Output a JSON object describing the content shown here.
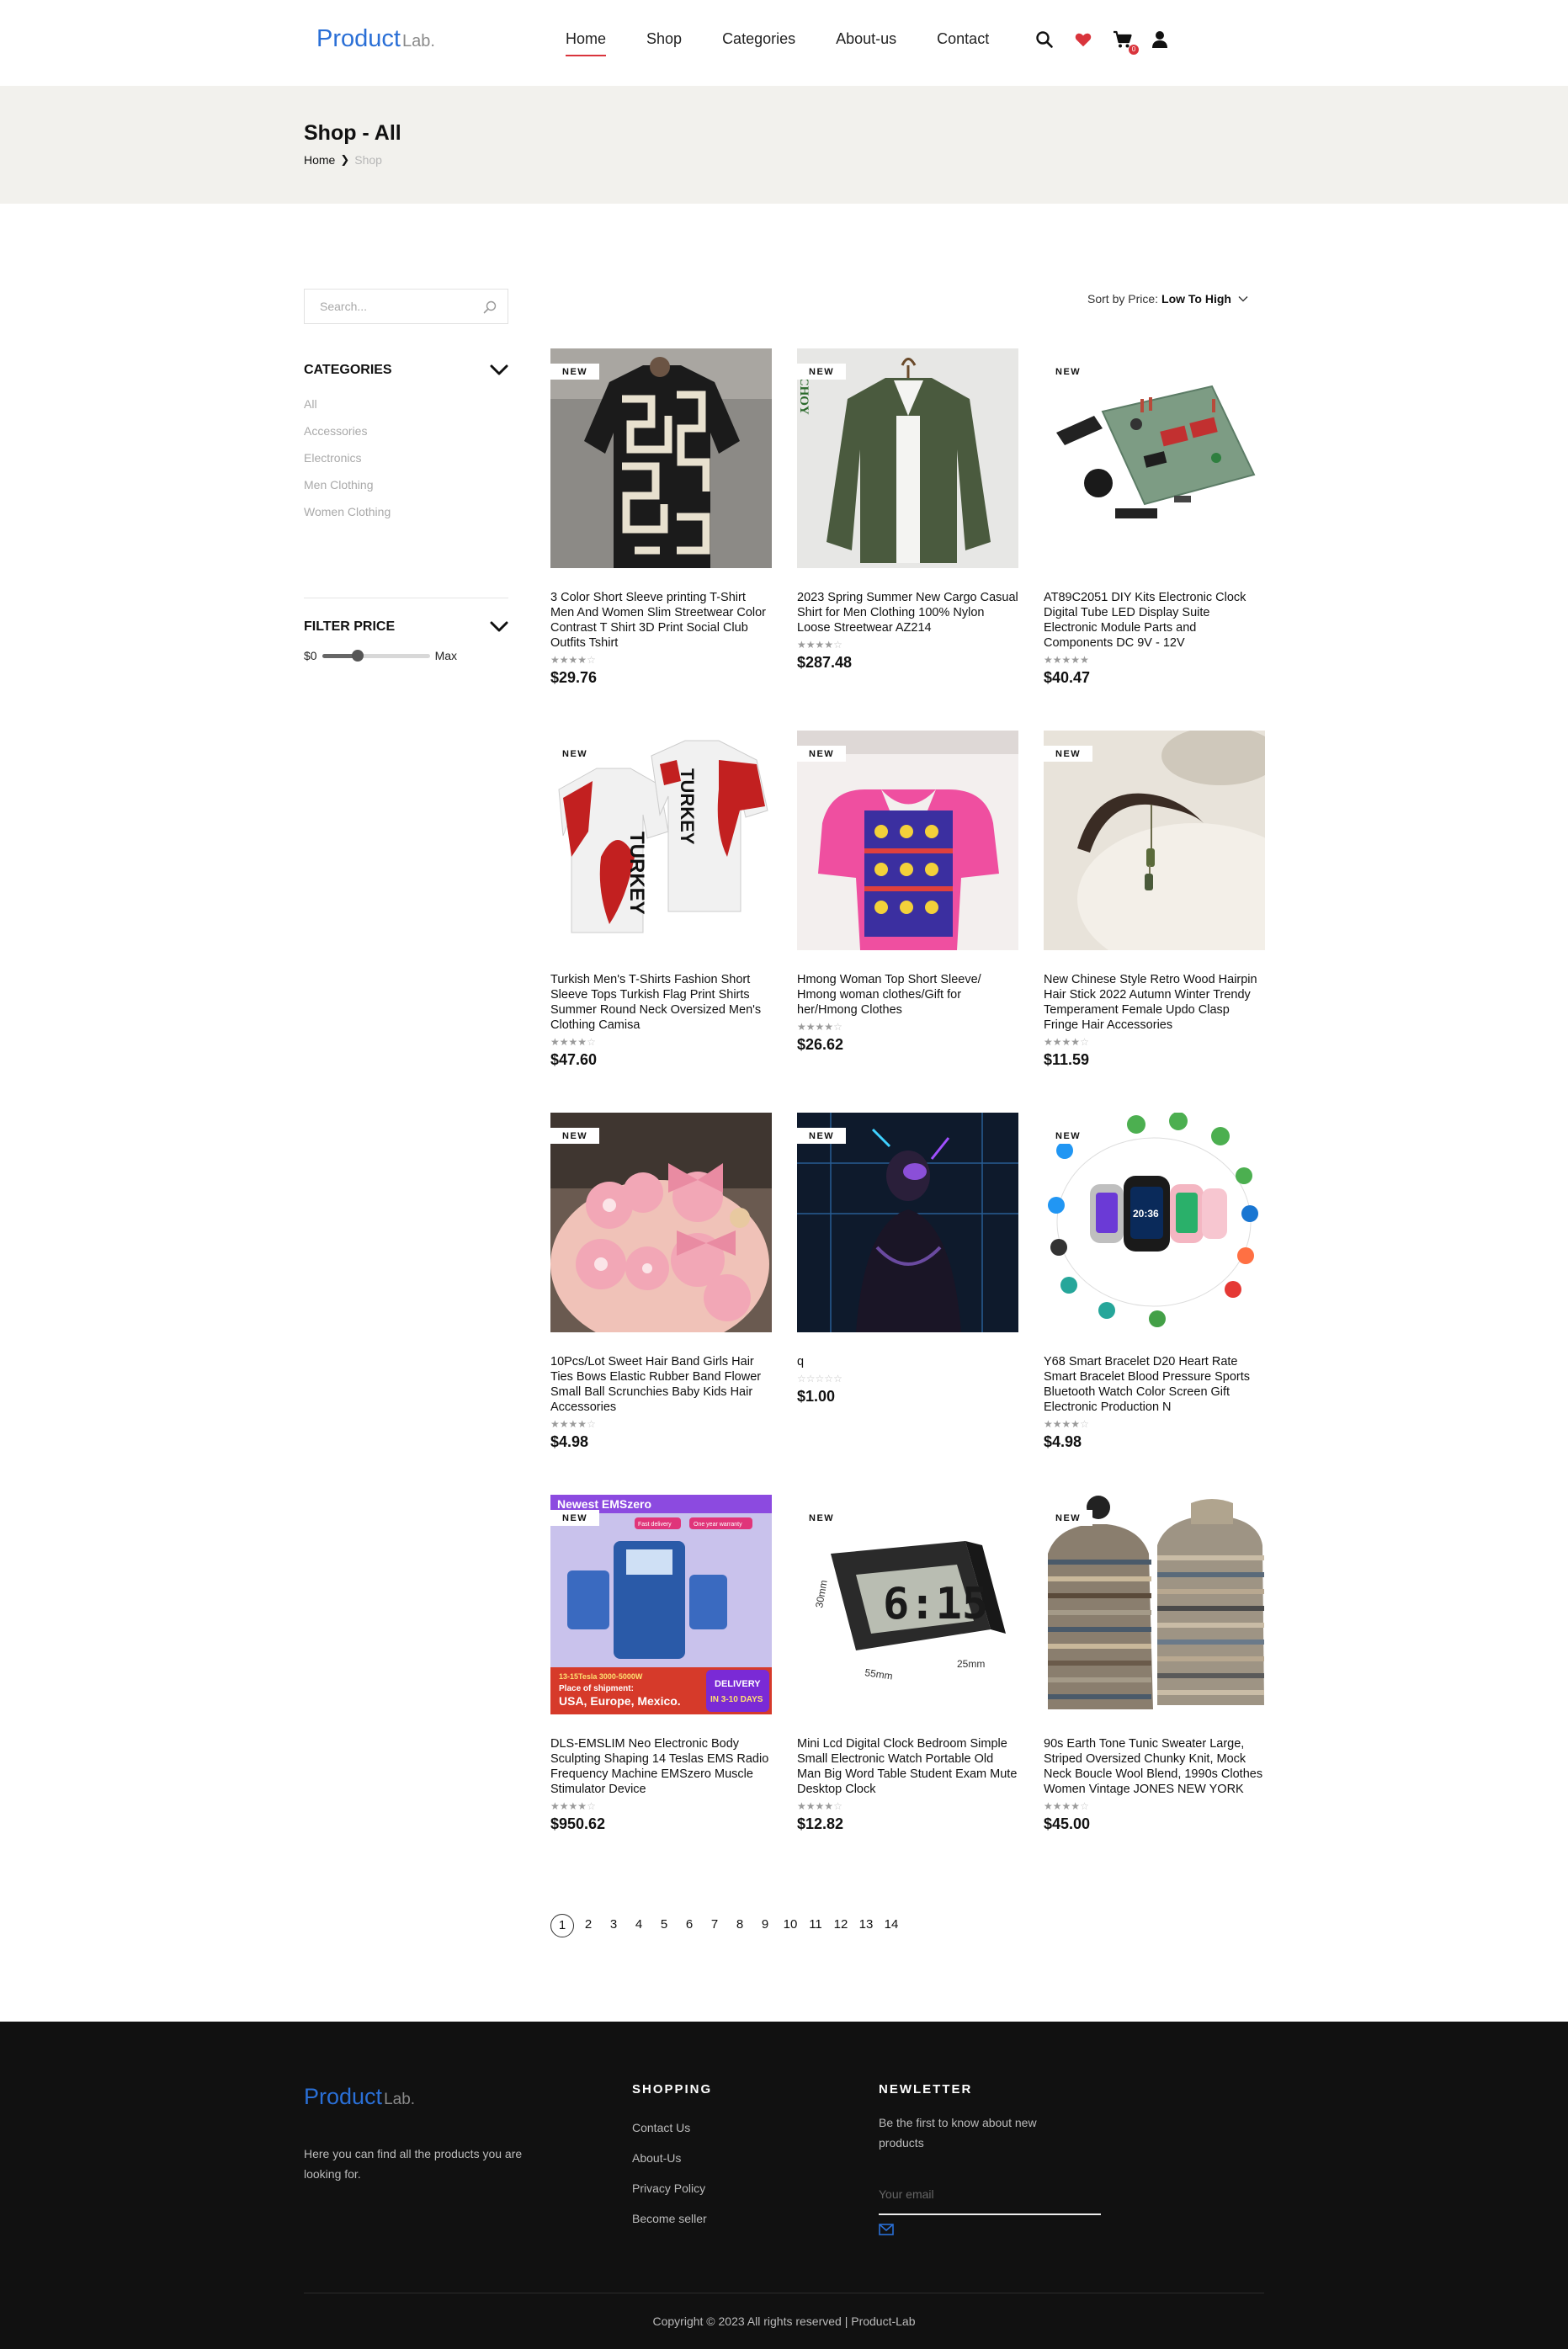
{
  "header": {
    "logo_main": "Product",
    "logo_sub": "Lab.",
    "nav": [
      "Home",
      "Shop",
      "Categories",
      "About-us",
      "Contact"
    ],
    "active_nav": "Home",
    "cart_count": "0",
    "icons": [
      "search-icon",
      "heart-icon",
      "cart-icon",
      "user-icon"
    ],
    "accent_color": "#d9343c",
    "brand_color": "#2a6fd6"
  },
  "banner": {
    "title": "Shop - All",
    "breadcrumb_home": "Home",
    "breadcrumb_current": "Shop"
  },
  "sidebar": {
    "search_placeholder": "Search...",
    "categories_title": "CATEGORIES",
    "categories": [
      "All",
      "Accessories",
      "Electronics",
      "Men Clothing",
      "Women Clothing"
    ],
    "filter_title": "FILTER PRICE",
    "price_min_label": "$0",
    "price_max_label": "Max",
    "slider_fraction": 0.33
  },
  "sort": {
    "label": "Sort by Price:",
    "value": "Low To High"
  },
  "products": [
    {
      "name": "3 Color Short Sleeve printing T-Shirt Men And Women Slim Streetwear Color Contrast T Shirt 3D Print Social Club Outfits Tshirt",
      "price": "$29.76",
      "badge": "NEW",
      "rating": 4,
      "image": "patterned-tshirt"
    },
    {
      "name": "2023 Spring Summer New Cargo Casual Shirt for Men Clothing 100% Nylon Loose Streetwear AZ214",
      "price": "$287.48",
      "badge": "NEW",
      "rating": 4,
      "image": "green-jacket"
    },
    {
      "name": "AT89C2051 DIY Kits Electronic Clock Digital Tube LED Display Suite Electronic Module Parts and Components DC 9V - 12V",
      "price": "$40.47",
      "badge": "NEW",
      "rating": 5,
      "image": "circuit-kit"
    },
    {
      "name": "Turkish Men's T-Shirts Fashion Short Sleeve Tops Turkish Flag Print Shirts Summer Round Neck Oversized Men's Clothing Camisa",
      "price": "$47.60",
      "badge": "NEW",
      "rating": 4,
      "image": "turkey-tshirt"
    },
    {
      "name": "Hmong Woman Top Short Sleeve/ Hmong woman clothes/Gift for her/Hmong Clothes",
      "price": "$26.62",
      "badge": "NEW",
      "rating": 4,
      "image": "hmong-top"
    },
    {
      "name": "New Chinese Style Retro Wood Hairpin Hair Stick 2022 Autumn Winter Trendy Temperament Female Updo Clasp Fringe Hair Accessories",
      "price": "$11.59",
      "badge": "NEW",
      "rating": 4,
      "image": "wood-hairpin"
    },
    {
      "name": "10Pcs/Lot Sweet Hair Band Girls Hair Ties Bows Elastic Rubber Band Flower Small Ball Scrunchies Baby Kids Hair Accessories",
      "price": "$4.98",
      "badge": "NEW",
      "rating": 4,
      "image": "pink-hair-ties"
    },
    {
      "name": "q",
      "price": "$1.00",
      "badge": "NEW",
      "rating": 0,
      "image": "cyberpunk-figure"
    },
    {
      "name": "Y68 Smart Bracelet D20 Heart Rate Smart Bracelet Blood Pressure Sports Bluetooth Watch Color Screen Gift Electronic Production N",
      "price": "$4.98",
      "badge": "NEW",
      "rating": 4,
      "image": "smart-bracelet"
    },
    {
      "name": "DLS-EMSLIM Neo Electronic Body Sculpting Shaping 14 Teslas EMS Radio Frequency Machine EMSzero Muscle Stimulator Device",
      "price": "$950.62",
      "badge": "NEW",
      "rating": 4,
      "image": "ems-machine"
    },
    {
      "name": "Mini Lcd Digital Clock Bedroom Simple Small Electronic Watch Portable Old Man Big Word Table Student Exam Mute Desktop Clock",
      "price": "$12.82",
      "badge": "NEW",
      "rating": 4,
      "image": "lcd-clock"
    },
    {
      "name": "90s Earth Tone Tunic Sweater Large, Striped Oversized Chunky Knit, Mock Neck Boucle Wool Blend, 1990s Clothes Women Vintage JONES NEW YORK",
      "price": "$45.00",
      "badge": "NEW",
      "rating": 4,
      "image": "striped-sweater"
    }
  ],
  "image_text": {
    "jacket_brand": "B CHOY",
    "turkey_text": "TURKEY",
    "ems_title": "Newest EMSzero",
    "ems_tag1": "Fast delivery",
    "ems_tag2": "One year warranty",
    "ems_spec": "13-15Tesla 3000-5000W",
    "ems_ship": "Place of shipment:",
    "ems_places": "USA, Europe, Mexico.",
    "ems_delivery1": "DELIVERY",
    "ems_delivery2": "IN 3-10 DAYS",
    "clock_time": "6:15",
    "clock_w": "55mm",
    "clock_h": "30mm",
    "clock_d": "25mm",
    "watch_time": "20:36"
  },
  "pagination": {
    "pages": [
      "1",
      "2",
      "3",
      "4",
      "5",
      "6",
      "7",
      "8",
      "9",
      "10",
      "11",
      "12",
      "13",
      "14"
    ],
    "current": "1"
  },
  "footer": {
    "logo_main": "Product",
    "logo_sub": "Lab.",
    "description": "Here you can find all the products you are looking for.",
    "shopping_title": "SHOPPING",
    "shopping_links": [
      "Contact Us",
      "About-Us",
      "Privacy Policy",
      "Become seller"
    ],
    "newsletter_title": "NEWLETTER",
    "newsletter_text": "Be the first to know about new products",
    "email_placeholder": "Your email",
    "copyright": "Copyright © 2023 All rights reserved | Product-Lab"
  }
}
